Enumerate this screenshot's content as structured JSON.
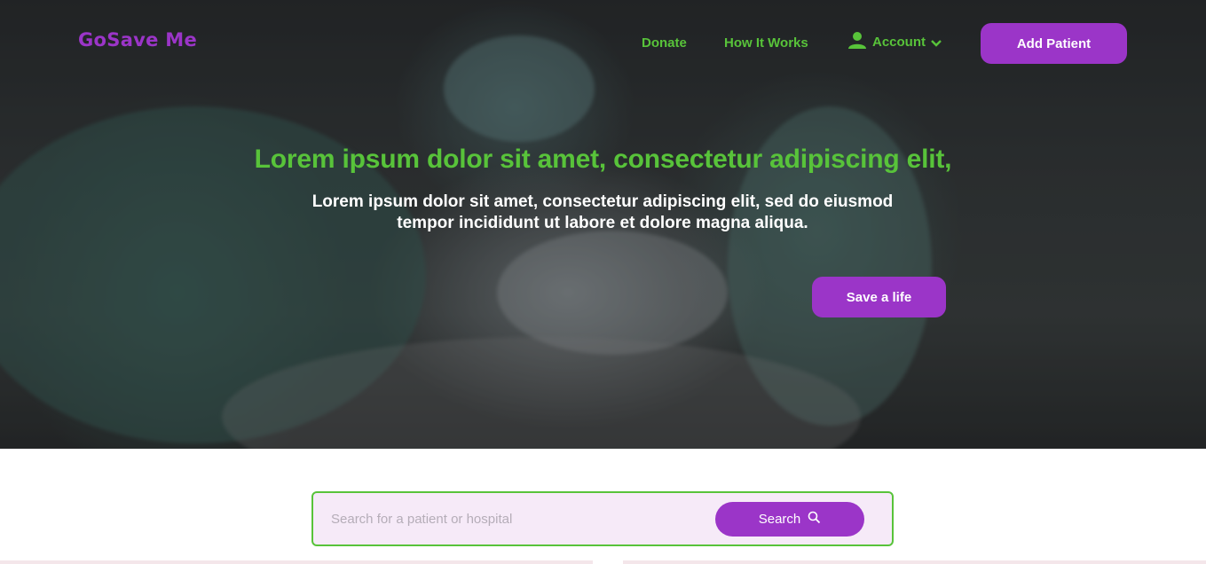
{
  "brand": {
    "name": "GoSave Me"
  },
  "nav": {
    "donate": "Donate",
    "how_it_works": "How It Works",
    "account": "Account",
    "add_patient": "Add Patient"
  },
  "hero": {
    "headline": "Lorem ipsum dolor sit amet, consectetur adipiscing elit,",
    "subline": "Lorem ipsum dolor sit amet, consectetur adipiscing elit, sed do eiusmod tempor incididunt ut labore et dolore magna aliqua.",
    "cta": "Save a life"
  },
  "search": {
    "placeholder": "Search for a patient or hospital",
    "button": "Search"
  },
  "icons": [
    "user-icon",
    "chevron-down-icon",
    "search-icon"
  ],
  "colors": {
    "brand_purple": "#9b35c8",
    "accent_green": "#58c33a",
    "search_bg": "#f6eaf8"
  }
}
